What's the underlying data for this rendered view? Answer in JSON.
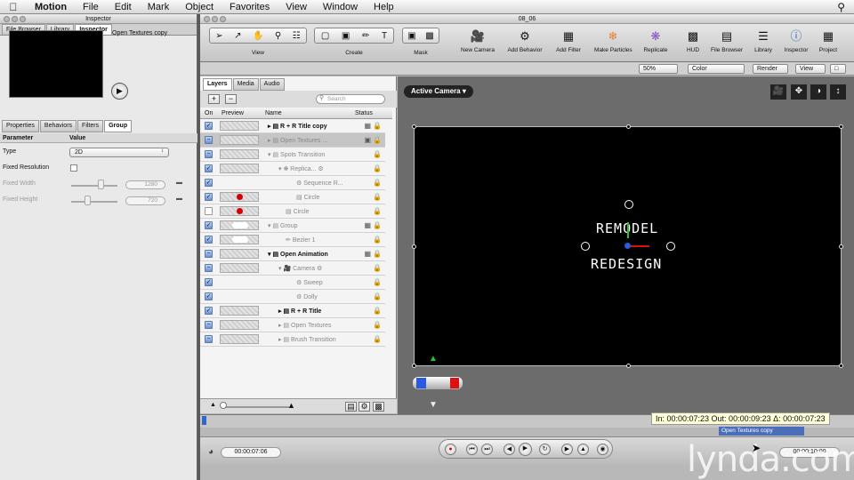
{
  "menubar": {
    "app": "Motion",
    "items": [
      "File",
      "Edit",
      "Mark",
      "Object",
      "Favorites",
      "View",
      "Window",
      "Help"
    ]
  },
  "inspector": {
    "window_title": "Inspector",
    "top_tabs": [
      "File Browser",
      "Library",
      "Inspector"
    ],
    "preview_name": "Open Textures copy",
    "tabs": [
      "Properties",
      "Behaviors",
      "Filters",
      "Group"
    ],
    "param_header": "Parameter",
    "value_header": "Value",
    "params": {
      "type_label": "Type",
      "type_value": "2D",
      "fixed_res_label": "Fixed Resolution",
      "fixed_width_label": "Fixed Width",
      "fixed_width_value": "1280",
      "fixed_height_label": "Fixed Height",
      "fixed_height_value": "720"
    }
  },
  "main": {
    "window_title": "08_06",
    "toolbar": {
      "groups": [
        "View",
        "Create",
        "Mask"
      ],
      "tools": [
        "New Camera",
        "Add Behavior",
        "Add Filter",
        "Make Particles",
        "Replicate",
        "HUD",
        "File Browser",
        "Library",
        "Inspector",
        "Project"
      ]
    },
    "viewbar": {
      "zoom": "50%",
      "channel": "Color",
      "render": "Render",
      "view": "View"
    }
  },
  "layers": {
    "tabs": [
      "Layers",
      "Media",
      "Audio"
    ],
    "search_placeholder": "Search",
    "columns": [
      "On",
      "Preview",
      "Name",
      "Status"
    ],
    "rows": [
      {
        "name": "R + R Title copy"
      },
      {
        "name": "Open Textures ..."
      },
      {
        "name": "Spots Transition"
      },
      {
        "name": "Replica..."
      },
      {
        "name": "Sequence R..."
      },
      {
        "name": "Circle"
      },
      {
        "name": "Circle"
      },
      {
        "name": "Group"
      },
      {
        "name": "Bezier 1"
      },
      {
        "name": "Open Animation"
      },
      {
        "name": "Camera"
      },
      {
        "name": "Sweep"
      },
      {
        "name": "Dolly"
      },
      {
        "name": "R + R Title"
      },
      {
        "name": "Open Textures"
      },
      {
        "name": "Brush Transition"
      }
    ]
  },
  "canvas": {
    "camera": "Active Camera",
    "line1": "REMODEL",
    "line2": "REDESIGN"
  },
  "timing": {
    "inout": "In: 00:00:07:23  Out: 00:00:09:23  Δ: 00:00:07:23",
    "clip_label": "Open Textures copy",
    "current": "00:00:07:06",
    "end": "00:00:10:00"
  },
  "watermark": "lynda.com",
  "colors": {
    "accent": "#4a6fb8",
    "selection": "#c5c5c5",
    "red_mark": "#d20000"
  }
}
